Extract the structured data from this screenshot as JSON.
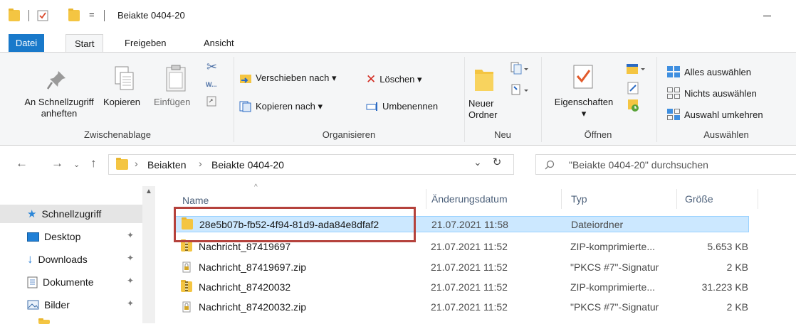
{
  "titlebar": {
    "title": "Beiakte 0404-20",
    "qa_dropdown": "="
  },
  "tabs": [
    {
      "label": "Datei"
    },
    {
      "label": "Start"
    },
    {
      "label": "Freigeben"
    },
    {
      "label": "Ansicht"
    }
  ],
  "ribbon": {
    "clipboard": {
      "pin_label_1": "An Schnellzugriff",
      "pin_label_2": "anheften",
      "copy": "Kopieren",
      "paste": "Einfügen",
      "group": "Zwischenablage"
    },
    "organize": {
      "move": "Verschieben nach ▾",
      "copy_to": "Kopieren nach ▾",
      "delete": "Löschen ▾",
      "rename": "Umbenennen",
      "group": "Organisieren"
    },
    "new": {
      "new_folder_1": "Neuer",
      "new_folder_2": "Ordner",
      "group": "Neu"
    },
    "open": {
      "properties": "Eigenschaften",
      "properties_arrow": "▾",
      "group": "Öffnen"
    },
    "select": {
      "select_all": "Alles auswählen",
      "select_none": "Nichts auswählen",
      "invert": "Auswahl umkehren",
      "group": "Auswählen"
    }
  },
  "address": {
    "sep1": "›",
    "crumb1": "Beiakten",
    "sep2": "›",
    "crumb2": "Beiakte 0404-20",
    "dropdown": "⌄",
    "refresh": "↻",
    "search_placeholder": "\"Beiakte 0404-20\" durchsuchen"
  },
  "navpane": {
    "items": [
      {
        "label": "Schnellzugriff"
      },
      {
        "label": "Desktop"
      },
      {
        "label": "Downloads"
      },
      {
        "label": "Dokumente"
      },
      {
        "label": "Bilder"
      }
    ],
    "pin": "📌"
  },
  "columns": {
    "name": "Name",
    "date": "Änderungsdatum",
    "type": "Typ",
    "size": "Größe"
  },
  "files": [
    {
      "name": "28e5b07b-fb52-4f94-81d9-ada84e8dfaf2",
      "date": "21.07.2021 11:58",
      "type": "Dateiordner",
      "size": "",
      "icon": "folder-icon"
    },
    {
      "name": "Nachricht_87419697",
      "date": "21.07.2021 11:52",
      "type": "ZIP-komprimierte...",
      "size": "5.653 KB",
      "icon": "zip-folder-icon"
    },
    {
      "name": "Nachricht_87419697.zip",
      "date": "21.07.2021 11:52",
      "type": "\"PKCS #7\"-Signatur",
      "size": "2 KB",
      "icon": "signature-file-icon"
    },
    {
      "name": "Nachricht_87420032",
      "date": "21.07.2021 11:52",
      "type": "ZIP-komprimierte...",
      "size": "31.223 KB",
      "icon": "zip-folder-icon"
    },
    {
      "name": "Nachricht_87420032.zip",
      "date": "21.07.2021 11:52",
      "type": "\"PKCS #7\"-Signatur",
      "size": "2 KB",
      "icon": "signature-file-icon"
    }
  ],
  "colors": {
    "accent": "#1979ca",
    "selection": "#cce8ff",
    "highlight_box": "#b5423c"
  }
}
